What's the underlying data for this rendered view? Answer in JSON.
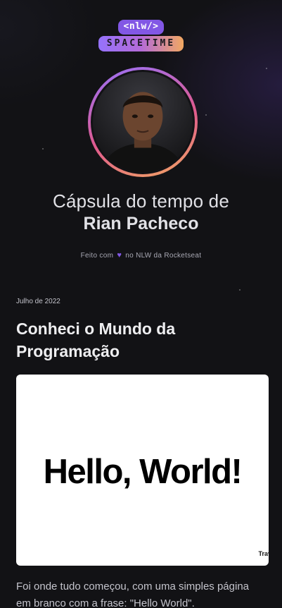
{
  "logo": {
    "top_text": "<nlw/>",
    "bottom_text": "SPACETIME"
  },
  "profile": {
    "title_prefix": "Cápsula do tempo de",
    "name": "Rian Pacheco",
    "avatar_icon": "user-photo"
  },
  "credit": {
    "before": "Feito com",
    "icon": "heart-icon",
    "after": "no NLW da Rocketseat"
  },
  "memory": {
    "date": "Julho de 2022",
    "title": "Conheci o Mundo da Programação",
    "image_text": "Hello, World!",
    "image_watermark": "Trav",
    "body": "Foi onde tudo começou, com uma simples página em branco com a frase: \"Hello World\"."
  },
  "colors": {
    "accent": "#8257e5",
    "background": "#121215",
    "gradient_end": "#f2a861"
  }
}
